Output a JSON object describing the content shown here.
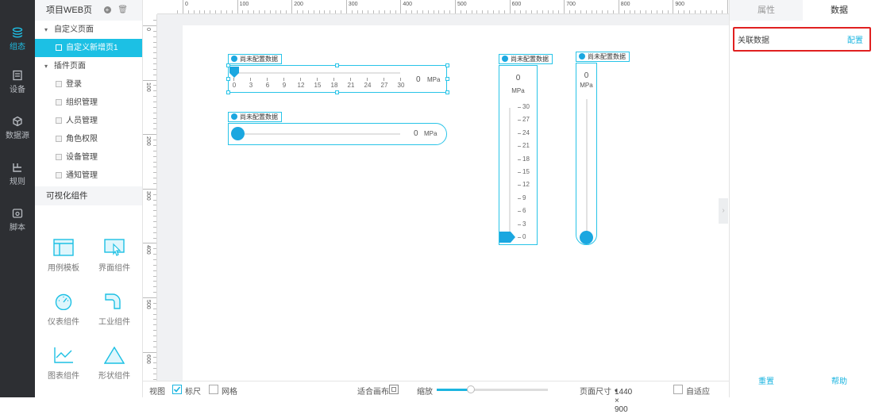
{
  "nav": [
    {
      "label": "组态",
      "icon": "layers-icon",
      "active": true
    },
    {
      "label": "设备",
      "icon": "device-icon",
      "active": false
    },
    {
      "label": "数据源",
      "icon": "cube-icon",
      "active": false
    },
    {
      "label": "规则",
      "icon": "rule-icon",
      "active": false
    },
    {
      "label": "脚本",
      "icon": "script-icon",
      "active": false
    }
  ],
  "sidebar": {
    "project_title": "项目WEB页",
    "tree": [
      {
        "label": "自定义页面",
        "level": 1,
        "type": "folder"
      },
      {
        "label": "自定义新增页1",
        "level": 2,
        "type": "page",
        "selected": true
      },
      {
        "label": "插件页面",
        "level": 1,
        "type": "folder"
      },
      {
        "label": "登录",
        "level": 2,
        "type": "page"
      },
      {
        "label": "组织管理",
        "level": 2,
        "type": "page"
      },
      {
        "label": "人员管理",
        "level": 2,
        "type": "page"
      },
      {
        "label": "角色权限",
        "level": 2,
        "type": "page"
      },
      {
        "label": "设备管理",
        "level": 2,
        "type": "page"
      },
      {
        "label": "通知管理",
        "level": 2,
        "type": "page"
      }
    ],
    "widgets_title": "可视化组件",
    "widgets": [
      {
        "label": "用例模板",
        "icon": "template-icon"
      },
      {
        "label": "界面组件",
        "icon": "ui-component-icon"
      },
      {
        "label": "仪表组件",
        "icon": "gauge-icon"
      },
      {
        "label": "工业组件",
        "icon": "pipe-icon"
      },
      {
        "label": "图表组件",
        "icon": "chart-icon"
      },
      {
        "label": "形状组件",
        "icon": "triangle-icon"
      }
    ]
  },
  "rulers": {
    "top": [
      "0",
      "100",
      "200",
      "300",
      "400",
      "500",
      "600",
      "700",
      "800",
      "900"
    ],
    "left": [
      "0",
      "100",
      "200",
      "300",
      "400",
      "500",
      "600"
    ]
  },
  "components": {
    "tag_label": "尚未配置数据",
    "h_gauge": {
      "value": "0",
      "unit": "MPa",
      "ticks": [
        "0",
        "3",
        "6",
        "9",
        "12",
        "15",
        "18",
        "21",
        "24",
        "27",
        "30"
      ]
    },
    "h_slider": {
      "value": "0",
      "unit": "MPa"
    },
    "v_gauge": {
      "value": "0",
      "unit": "MPa",
      "ticks": [
        "30",
        "27",
        "24",
        "21",
        "18",
        "15",
        "12",
        "9",
        "6",
        "3",
        "0"
      ]
    },
    "v_slider": {
      "value": "0",
      "unit": "MPa"
    }
  },
  "right_panel": {
    "tabs": [
      "属性",
      "数据"
    ],
    "active_tab": "数据",
    "data_label": "关联数据",
    "config_link": "配置",
    "reset_link": "重置",
    "help_link": "帮助"
  },
  "bottom_bar": {
    "view_label": "视图",
    "ruler_label": "标尺",
    "ruler_checked": true,
    "grid_label": "网格",
    "grid_checked": false,
    "fit_label": "适合画布",
    "zoom_label": "缩放",
    "page_size_label": "页面尺寸",
    "page_size_value": "1440 × 900",
    "auto_fit_label": "自适应",
    "auto_fit_checked": false
  },
  "colors": {
    "accent": "#1cc0e4",
    "nav_bg": "#2d2f33",
    "highlight_border": "#e02020"
  }
}
